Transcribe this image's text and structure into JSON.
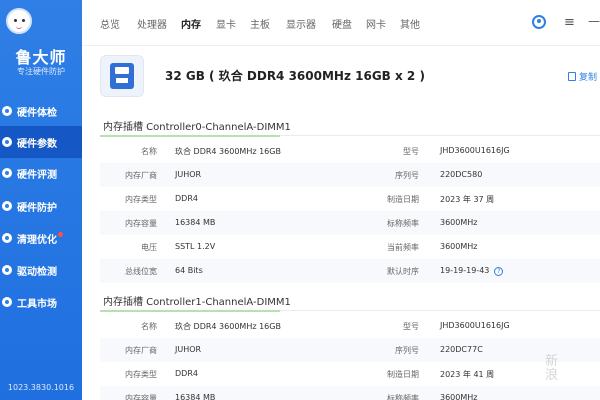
{
  "sidebar": {
    "logo_title": "鲁大师",
    "logo_sub": "专注硬件防护",
    "items": [
      {
        "label": "硬件体检"
      },
      {
        "label": "硬件参数"
      },
      {
        "label": "硬件评测"
      },
      {
        "label": "硬件防护"
      },
      {
        "label": "清理优化"
      },
      {
        "label": "驱动检测"
      },
      {
        "label": "工具市场"
      }
    ],
    "active_index": 1,
    "version": "1023.3830.1016"
  },
  "tabs": [
    {
      "label": "总览"
    },
    {
      "label": "处理器"
    },
    {
      "label": "内存"
    },
    {
      "label": "显卡"
    },
    {
      "label": "主板"
    },
    {
      "label": "显示器"
    },
    {
      "label": "硬盘"
    },
    {
      "label": "网卡"
    },
    {
      "label": "其他"
    }
  ],
  "active_tab": "内存",
  "window_controls": {
    "menu": "≡",
    "minimize": "—"
  },
  "summary": {
    "text": "32 GB ( 玖合 DDR4 3600MHz 16GB x 2 )",
    "copy_label": "复制"
  },
  "slots": [
    {
      "title": "内存插槽 Controller0-ChannelA-DIMM1",
      "rows": [
        {
          "l1": "名称",
          "v1": "玖合 DDR4 3600MHz 16GB",
          "l2": "型号",
          "v2": "JHD3600U1616JG"
        },
        {
          "l1": "内存厂商",
          "v1": "JUHOR",
          "l2": "序列号",
          "v2": "220DC580"
        },
        {
          "l1": "内存类型",
          "v1": "DDR4",
          "l2": "制造日期",
          "v2": "2023 年 37 周"
        },
        {
          "l1": "内存容量",
          "v1": "16384 MB",
          "l2": "标称频率",
          "v2": "3600MHz"
        },
        {
          "l1": "电压",
          "v1": "SSTL 1.2V",
          "l2": "当前频率",
          "v2": "3600MHz"
        },
        {
          "l1": "总线位宽",
          "v1": "64 Bits",
          "l2": "默认时序",
          "v2": "19-19-19-43"
        }
      ]
    },
    {
      "title": "内存插槽 Controller1-ChannelA-DIMM1",
      "rows": [
        {
          "l1": "名称",
          "v1": "玖合 DDR4 3600MHz 16GB",
          "l2": "型号",
          "v2": "JHD3600U1616JG"
        },
        {
          "l1": "内存厂商",
          "v1": "JUHOR",
          "l2": "序列号",
          "v2": "220DC77C"
        },
        {
          "l1": "内存类型",
          "v1": "DDR4",
          "l2": "制造日期",
          "v2": "2023 年 41 周"
        },
        {
          "l1": "内存容量",
          "v1": "16384 MB",
          "l2": "标称频率",
          "v2": "3600MHz"
        }
      ]
    }
  ],
  "help_glyph": "?",
  "watermark": "新\n浪"
}
